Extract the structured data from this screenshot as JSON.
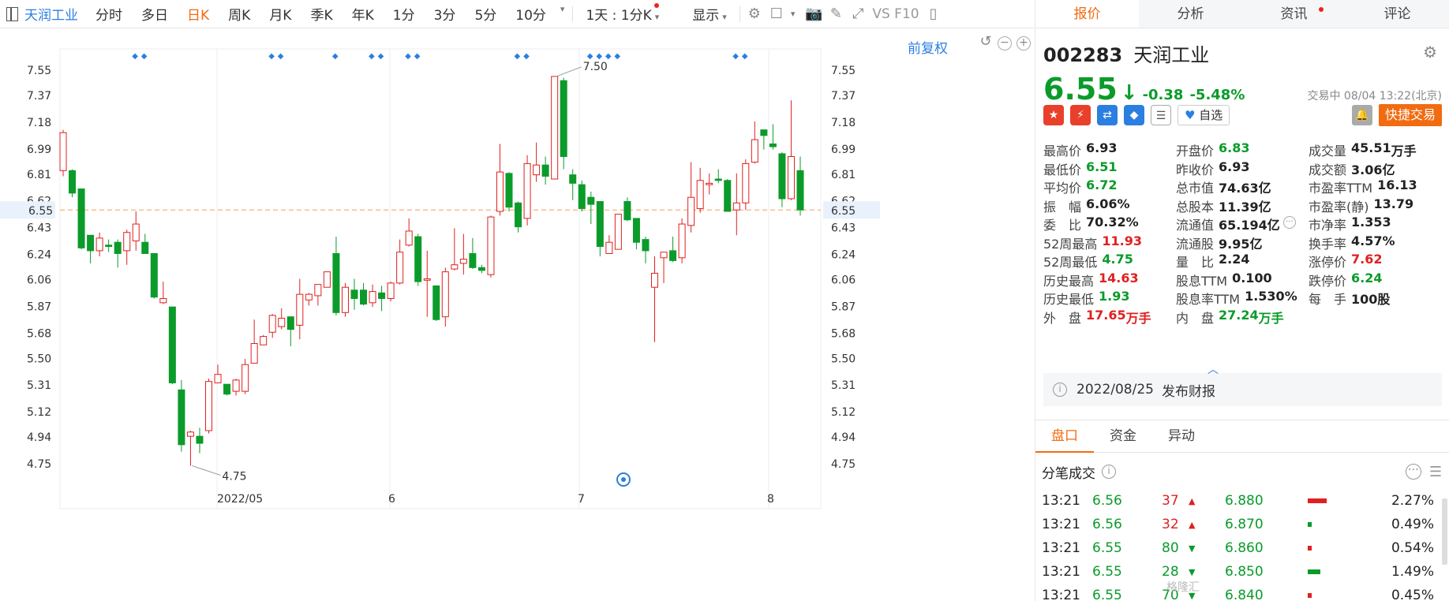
{
  "toolbar": {
    "stock_name": "天润工业",
    "periods": [
      "分时",
      "多日",
      "日K",
      "周K",
      "月K",
      "季K",
      "年K",
      "1分",
      "3分",
      "5分",
      "10分"
    ],
    "active_period": "日K",
    "interval_label": "1天 : 1分K",
    "display_label": "显示",
    "right_label": "VS F10"
  },
  "chart": {
    "restore_label": "前复权",
    "price_labels": [
      "7.55",
      "7.37",
      "7.18",
      "6.99",
      "6.81",
      "6.62",
      "6.43",
      "6.24",
      "6.06",
      "5.87",
      "5.68",
      "5.50",
      "5.31",
      "5.12",
      "4.94",
      "4.75"
    ],
    "current_price": "6.55",
    "max_label": "7.50",
    "min_label": "4.75",
    "x_labels": [
      "2022/05",
      "6",
      "7",
      "8"
    ],
    "colors": {
      "up": "#e02020",
      "down": "#0a9b2a",
      "dashed": "#f5a05a",
      "grid": "#eeeeee",
      "marker": "#2b7fe0"
    }
  },
  "chart_data": {
    "type": "candlestick",
    "ylim": [
      4.75,
      7.55
    ],
    "x_ticks": [
      "2022/05",
      "6",
      "7",
      "8"
    ],
    "candles": [
      [
        6.83,
        7.1,
        7.12,
        6.79
      ],
      [
        6.83,
        6.67,
        6.84,
        6.64
      ],
      [
        6.7,
        6.28,
        6.7,
        6.27
      ],
      [
        6.37,
        6.26,
        6.37,
        6.17
      ],
      [
        6.26,
        6.35,
        6.39,
        6.22
      ],
      [
        6.3,
        6.29,
        6.34,
        6.25
      ],
      [
        6.32,
        6.24,
        6.34,
        6.14
      ],
      [
        6.26,
        6.39,
        6.41,
        6.16
      ],
      [
        6.33,
        6.45,
        6.54,
        6.26
      ],
      [
        6.32,
        6.24,
        6.38,
        6.24
      ],
      [
        6.24,
        5.93,
        6.24,
        5.92
      ],
      [
        5.89,
        5.92,
        6.04,
        5.88
      ],
      [
        5.86,
        5.32,
        5.86,
        5.31
      ],
      [
        5.27,
        4.88,
        5.34,
        4.83
      ],
      [
        4.94,
        4.97,
        4.98,
        4.73
      ],
      [
        4.94,
        4.89,
        5.0,
        4.82
      ],
      [
        4.98,
        5.33,
        5.35,
        4.96
      ],
      [
        5.32,
        5.38,
        5.45,
        5.32
      ],
      [
        5.31,
        5.24,
        5.31,
        5.23
      ],
      [
        5.26,
        5.34,
        5.35,
        5.23
      ],
      [
        5.26,
        5.45,
        5.49,
        5.24
      ],
      [
        5.46,
        5.6,
        5.77,
        5.46
      ],
      [
        5.59,
        5.65,
        5.66,
        5.59
      ],
      [
        5.68,
        5.8,
        5.81,
        5.64
      ],
      [
        5.72,
        5.78,
        5.85,
        5.7
      ],
      [
        5.79,
        5.7,
        5.79,
        5.58
      ],
      [
        5.73,
        5.95,
        6.06,
        5.63
      ],
      [
        5.91,
        5.95,
        5.96,
        5.87
      ],
      [
        5.94,
        6.02,
        6.02,
        5.87
      ],
      [
        6.0,
        6.11,
        6.11,
        6.0
      ],
      [
        6.24,
        5.82,
        6.36,
        5.8
      ],
      [
        5.82,
        6.0,
        6.03,
        5.79
      ],
      [
        5.98,
        5.92,
        6.06,
        5.84
      ],
      [
        5.98,
        5.88,
        6.03,
        5.87
      ],
      [
        5.89,
        5.97,
        6.02,
        5.86
      ],
      [
        5.96,
        5.92,
        6.01,
        5.83
      ],
      [
        5.92,
        6.03,
        6.04,
        5.9
      ],
      [
        6.03,
        6.25,
        6.34,
        6.02
      ],
      [
        6.3,
        6.4,
        6.49,
        6.29
      ],
      [
        6.36,
        6.04,
        6.38,
        6.01
      ],
      [
        6.05,
        6.06,
        6.26,
        5.79
      ],
      [
        6.01,
        5.77,
        6.01,
        5.76
      ],
      [
        5.79,
        6.11,
        6.14,
        5.72
      ],
      [
        6.13,
        6.16,
        6.42,
        6.12
      ],
      [
        6.17,
        6.2,
        6.38,
        6.09
      ],
      [
        6.24,
        6.14,
        6.35,
        6.13
      ],
      [
        6.14,
        6.12,
        6.16,
        6.1
      ],
      [
        6.09,
        6.5,
        6.51,
        6.07
      ],
      [
        6.54,
        6.82,
        7.02,
        6.51
      ],
      [
        6.81,
        6.57,
        6.82,
        6.54
      ],
      [
        6.6,
        6.43,
        6.61,
        6.39
      ],
      [
        6.49,
        6.88,
        6.94,
        6.44
      ],
      [
        6.8,
        6.87,
        7.03,
        6.75
      ],
      [
        6.87,
        6.79,
        6.93,
        6.73
      ],
      [
        6.77,
        7.5,
        7.5,
        6.77
      ],
      [
        7.47,
        6.93,
        7.49,
        6.84
      ],
      [
        6.8,
        6.74,
        6.84,
        6.62
      ],
      [
        6.73,
        6.56,
        6.76,
        6.54
      ],
      [
        6.64,
        6.59,
        6.68,
        6.45
      ],
      [
        6.61,
        6.29,
        6.61,
        6.22
      ],
      [
        6.24,
        6.32,
        6.37,
        6.24
      ],
      [
        6.27,
        6.52,
        6.52,
        6.27
      ],
      [
        6.61,
        6.48,
        6.64,
        6.47
      ],
      [
        6.49,
        6.32,
        6.49,
        6.27
      ],
      [
        6.34,
        6.26,
        6.36,
        6.17
      ],
      [
        6.0,
        6.1,
        6.22,
        5.61
      ],
      [
        6.21,
        6.25,
        6.25,
        6.03
      ],
      [
        6.26,
        6.19,
        6.36,
        6.18
      ],
      [
        6.21,
        6.45,
        6.49,
        6.17
      ],
      [
        6.44,
        6.64,
        6.89,
        6.39
      ],
      [
        6.56,
        6.76,
        6.85,
        6.53
      ],
      [
        6.73,
        6.74,
        6.81,
        6.66
      ],
      [
        6.77,
        6.76,
        6.84,
        6.74
      ],
      [
        6.76,
        6.54,
        6.77,
        6.54
      ],
      [
        6.55,
        6.6,
        6.81,
        6.37
      ],
      [
        6.6,
        6.88,
        6.91,
        6.55
      ],
      [
        6.89,
        7.05,
        7.18,
        6.88
      ],
      [
        7.12,
        7.08,
        7.12,
        6.98
      ],
      [
        7.02,
        7.0,
        7.16,
        6.98
      ],
      [
        6.95,
        6.63,
        6.96,
        6.57
      ],
      [
        6.63,
        6.93,
        7.33,
        6.62
      ],
      [
        6.83,
        6.55,
        6.93,
        6.51
      ]
    ],
    "current_price": 6.55,
    "max_point": 7.5,
    "min_point": 4.75
  },
  "quote": {
    "code": "002283",
    "name": "天润工业",
    "price": "6.55",
    "change": "-0.38",
    "change_pct": "-5.48%",
    "status": "交易中 08/04 13:22(北京)",
    "watch_label": "自选",
    "trade_label": "快捷交易",
    "stats": [
      [
        {
          "l": "最高价",
          "v": "6.93",
          "c": ""
        },
        {
          "l": "开盘价",
          "v": "6.83",
          "c": "green"
        },
        {
          "l": "成交量",
          "v": "45.51",
          "u": "万手",
          "c": ""
        }
      ],
      [
        {
          "l": "最低价",
          "v": "6.51",
          "c": "green"
        },
        {
          "l": "昨收价",
          "v": "6.93",
          "c": ""
        },
        {
          "l": "成交额",
          "v": "3.06亿",
          "c": ""
        }
      ],
      [
        {
          "l": "平均价",
          "v": "6.72",
          "c": "green"
        },
        {
          "l": "总市值",
          "v": "74.63亿",
          "c": ""
        },
        {
          "l": "市盈率TTM",
          "v": "16.13",
          "c": ""
        }
      ],
      [
        {
          "l": "振　幅",
          "v": "6.06%",
          "c": ""
        },
        {
          "l": "总股本",
          "v": "11.39亿",
          "c": ""
        },
        {
          "l": "市盈率(静)",
          "v": "13.79",
          "c": ""
        }
      ],
      [
        {
          "l": "委　比",
          "v": "70.32%",
          "c": ""
        },
        {
          "l": "流通值",
          "v": "65.194亿",
          "c": ""
        },
        {
          "l": "市净率",
          "v": "1.353",
          "c": ""
        }
      ],
      [
        {
          "l": "52周最高",
          "v": "11.93",
          "c": "red"
        },
        {
          "l": "流通股",
          "v": "9.95亿",
          "c": ""
        },
        {
          "l": "换手率",
          "v": "4.57%",
          "c": ""
        }
      ],
      [
        {
          "l": "52周最低",
          "v": "4.75",
          "c": "green"
        },
        {
          "l": "量　比",
          "v": "2.24",
          "c": ""
        },
        {
          "l": "涨停价",
          "v": "7.62",
          "c": "red"
        }
      ],
      [
        {
          "l": "历史最高",
          "v": "14.63",
          "c": "red"
        },
        {
          "l": "股息TTM",
          "v": "0.100",
          "c": ""
        },
        {
          "l": "跌停价",
          "v": "6.24",
          "c": "green"
        }
      ],
      [
        {
          "l": "历史最低",
          "v": "1.93",
          "c": "green"
        },
        {
          "l": "股息率TTM",
          "v": "1.530%",
          "c": ""
        },
        {
          "l": "每　手",
          "v": "100股",
          "c": ""
        }
      ],
      [
        {
          "l": "外　盘",
          "v": "17.65",
          "u": "万手",
          "c": "red"
        },
        {
          "l": "内　盘",
          "v": "27.24",
          "u": "万手",
          "c": "green"
        }
      ]
    ],
    "report_date": "2022/08/25",
    "report_label": "发布财报"
  },
  "right_tabs": [
    "报价",
    "分析",
    "资讯",
    "评论"
  ],
  "panel_tabs": [
    "盘口",
    "资金",
    "异动"
  ],
  "ticks_title": "分笔成交",
  "ticks": [
    {
      "t": "13:21",
      "p": "6.56",
      "v": "37",
      "d": "up",
      "b": "6.880",
      "pct": "2.27%",
      "bar_w": 24,
      "bar_c": "#e02020"
    },
    {
      "t": "13:21",
      "p": "6.56",
      "v": "32",
      "d": "up",
      "b": "6.870",
      "pct": "0.49%",
      "bar_w": 5,
      "bar_c": "#0a9b2a"
    },
    {
      "t": "13:21",
      "p": "6.55",
      "v": "80",
      "d": "dn",
      "b": "6.860",
      "pct": "0.54%",
      "bar_w": 5,
      "bar_c": "#e02020"
    },
    {
      "t": "13:21",
      "p": "6.55",
      "v": "28",
      "d": "dn",
      "b": "6.850",
      "pct": "1.49%",
      "bar_w": 16,
      "bar_c": "#0a9b2a"
    },
    {
      "t": "13:21",
      "p": "6.55",
      "v": "70",
      "d": "dn",
      "b": "6.840",
      "pct": "0.45%",
      "bar_w": 5,
      "bar_c": "#e02020"
    }
  ],
  "watermark": "格隆汇"
}
